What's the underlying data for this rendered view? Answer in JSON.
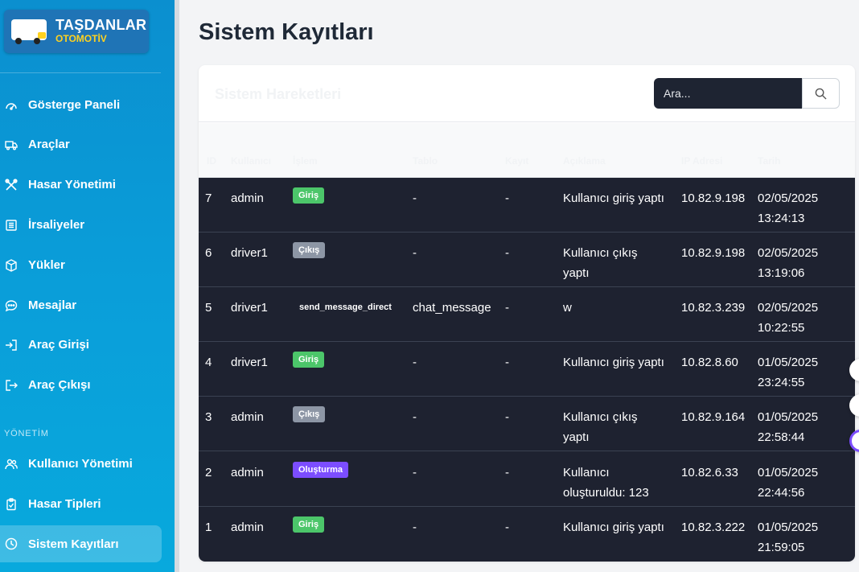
{
  "brand": {
    "name": "TAŞDANLAR",
    "sub": "OTOMOTİV"
  },
  "sidebar": {
    "items": [
      {
        "label": "Gösterge Paneli",
        "icon": "gauge-icon"
      },
      {
        "label": "Araçlar",
        "icon": "truck-icon"
      },
      {
        "label": "Hasar Yönetimi",
        "icon": "tools-icon"
      },
      {
        "label": "İrsaliyeler",
        "icon": "list-icon"
      },
      {
        "label": "Yükler",
        "icon": "box-icon"
      },
      {
        "label": "Mesajlar",
        "icon": "chat-icon"
      },
      {
        "label": "Araç Girişi",
        "icon": "enter-icon"
      },
      {
        "label": "Araç Çıkışı",
        "icon": "exit-icon"
      }
    ],
    "section": "YÖNETİM",
    "admin_items": [
      {
        "label": "Kullanıcı Yönetimi",
        "icon": "users-icon"
      },
      {
        "label": "Hasar Tipleri",
        "icon": "clipboard-icon"
      },
      {
        "label": "Sistem Kayıtları",
        "icon": "clock-icon",
        "active": true
      }
    ]
  },
  "page": {
    "title": "Sistem Kayıtları"
  },
  "card": {
    "title": "Sistem Hareketleri"
  },
  "search": {
    "placeholder": "Ara..."
  },
  "table": {
    "headers": [
      "ID",
      "Kullanıcı",
      "İşlem",
      "Tablo",
      "Kayıt",
      "Açıklama",
      "IP Adresi",
      "Tarih"
    ],
    "rows": [
      {
        "id": "7",
        "user": "admin",
        "action": "Giriş",
        "type": "login",
        "table": "-",
        "record": "-",
        "desc1": "Kullanıcı giriş yaptı",
        "desc2": "",
        "ip": "10.82.9.198",
        "date": "02/05/2025",
        "time": "13:24:13"
      },
      {
        "id": "6",
        "user": "driver1",
        "action": "Çıkış",
        "type": "logout",
        "table": "-",
        "record": "-",
        "desc1": "Kullanıcı çıkış",
        "desc2": "yaptı",
        "ip": "10.82.9.198",
        "date": "02/05/2025",
        "time": "13:19:06"
      },
      {
        "id": "5",
        "user": "driver1",
        "action": "send_message_direct",
        "type": "plain",
        "table": "chat_message",
        "record": "-",
        "desc1": "w",
        "desc2": "",
        "ip": "10.82.3.239",
        "date": "02/05/2025",
        "time": "10:22:55"
      },
      {
        "id": "4",
        "user": "driver1",
        "action": "Giriş",
        "type": "login",
        "table": "-",
        "record": "-",
        "desc1": "Kullanıcı giriş yaptı",
        "desc2": "",
        "ip": "10.82.8.60",
        "date": "01/05/2025",
        "time": "23:24:55"
      },
      {
        "id": "3",
        "user": "admin",
        "action": "Çıkış",
        "type": "logout",
        "table": "-",
        "record": "-",
        "desc1": "Kullanıcı çıkış",
        "desc2": "yaptı",
        "ip": "10.82.9.164",
        "date": "01/05/2025",
        "time": "22:58:44"
      },
      {
        "id": "2",
        "user": "admin",
        "action": "Oluşturma",
        "type": "create",
        "table": "-",
        "record": "-",
        "desc1": "Kullanıcı",
        "desc2": "oluşturuldu: 123",
        "ip": "10.82.6.33",
        "date": "01/05/2025",
        "time": "22:44:56"
      },
      {
        "id": "1",
        "user": "admin",
        "action": "Giriş",
        "type": "login",
        "table": "-",
        "record": "-",
        "desc1": "Kullanıcı giriş yaptı",
        "desc2": "",
        "ip": "10.82.3.222",
        "date": "01/05/2025",
        "time": "21:59:05"
      }
    ]
  },
  "colors": {
    "sidebar": "#0a9ed9",
    "table_bg": "#1e2230",
    "login": "#4cc66a",
    "logout": "#8d96a5",
    "create": "#7c4dff"
  }
}
